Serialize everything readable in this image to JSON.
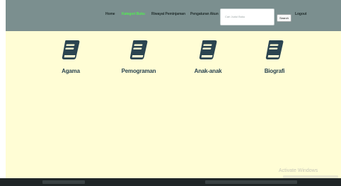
{
  "navbar": {
    "links": [
      {
        "label": "Home",
        "active": false
      },
      {
        "label": "Kategori Buku",
        "active": true
      },
      {
        "label": "Riwayat Peminjaman",
        "active": false
      },
      {
        "label": "Pengaturan Akun",
        "active": false
      }
    ],
    "search_placeholder": "Cari Judul Buku",
    "search_button": "Search",
    "logout": "Logout"
  },
  "categories": [
    {
      "label": "Agama",
      "icon": "book-icon"
    },
    {
      "label": "Pemograman",
      "icon": "book-icon"
    },
    {
      "label": "Anak-anak",
      "icon": "book-icon"
    },
    {
      "label": "Biografi",
      "icon": "book-icon"
    }
  ],
  "watermark": {
    "title": "Activate Windows"
  },
  "colors": {
    "navbar_bg": "#7b8f8f",
    "page_bg": "#fffdd5",
    "active_link": "#53ec53",
    "icon": "#2b4450"
  }
}
